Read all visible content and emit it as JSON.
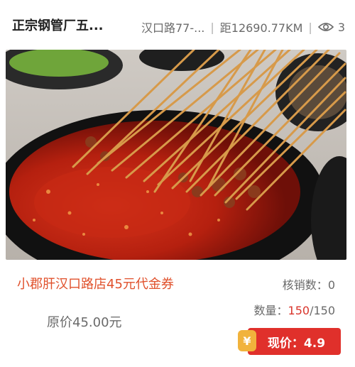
{
  "header": {
    "shop_name": "正宗钢管厂五...",
    "address": "汉口路77-...",
    "distance": "距12690.77KM",
    "views": "3"
  },
  "photo": {
    "icon": "skewer-hotpot-photo"
  },
  "deal": {
    "title": "小郡肝汉口路店45元代金券",
    "original_price": "原价45.00元",
    "redeemed_label": "核销数：",
    "redeemed_value": "0",
    "quantity_label": "数量：",
    "quantity_remaining": "150",
    "quantity_total": "/150",
    "price_badge": "¥",
    "current_price": "现价：4.9"
  },
  "colors": {
    "accent_red": "#e0302b",
    "title_orange": "#e0502b",
    "badge_yellow": "#f1b33c"
  }
}
